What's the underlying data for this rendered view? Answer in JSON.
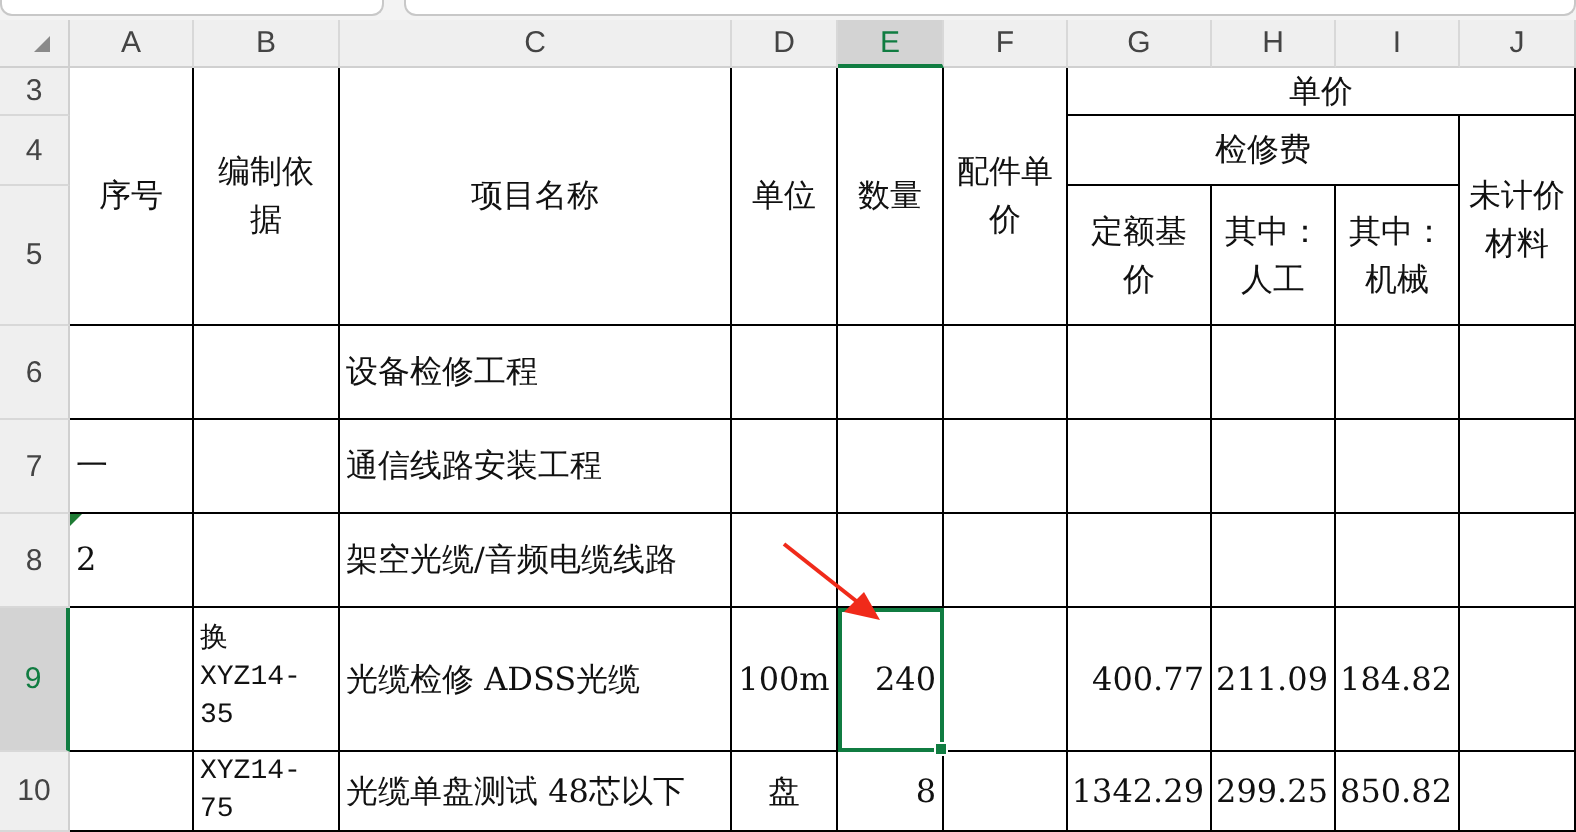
{
  "columns": [
    {
      "label": "A",
      "selected": false
    },
    {
      "label": "B",
      "selected": false
    },
    {
      "label": "C",
      "selected": false
    },
    {
      "label": "D",
      "selected": false
    },
    {
      "label": "E",
      "selected": true
    },
    {
      "label": "F",
      "selected": false
    },
    {
      "label": "G",
      "selected": false
    },
    {
      "label": "H",
      "selected": false
    },
    {
      "label": "I",
      "selected": false
    },
    {
      "label": "J",
      "selected": false
    }
  ],
  "header_row_numbers": [
    "3",
    "4",
    "5"
  ],
  "header_cells": [
    "序号",
    "编制依据",
    "项目名称",
    "单位",
    "数量",
    "配件单价",
    "单价",
    "检修费",
    "未计价材料",
    "定额基价",
    "其中：人工",
    "其中：机械"
  ],
  "rows": [
    {
      "number": "6",
      "selected": false,
      "marker": false,
      "name": "设备检修工程"
    },
    {
      "number": "7",
      "selected": false,
      "marker": false,
      "sequence": "一",
      "name": "通信线路安装工程"
    },
    {
      "number": "8",
      "selected": false,
      "marker": true,
      "sequence": "2",
      "name": "架空光缆/音频电缆线路"
    },
    {
      "number": "9",
      "selected": true,
      "marker": false,
      "basis": "换XYZ14-35",
      "name": "光缆检修 ADSS光缆",
      "unit": "100m",
      "quantity": "240",
      "base_price": "400.77",
      "labor": "211.09",
      "machinery": "184.82"
    },
    {
      "number": "10",
      "selected": false,
      "marker": false,
      "basis": "XYZ14-75",
      "name": "光缆单盘测试 48芯以下",
      "unit": "盘",
      "quantity": "8",
      "base_price": "1342.29",
      "labor": "299.25",
      "machinery": "850.82"
    }
  ]
}
